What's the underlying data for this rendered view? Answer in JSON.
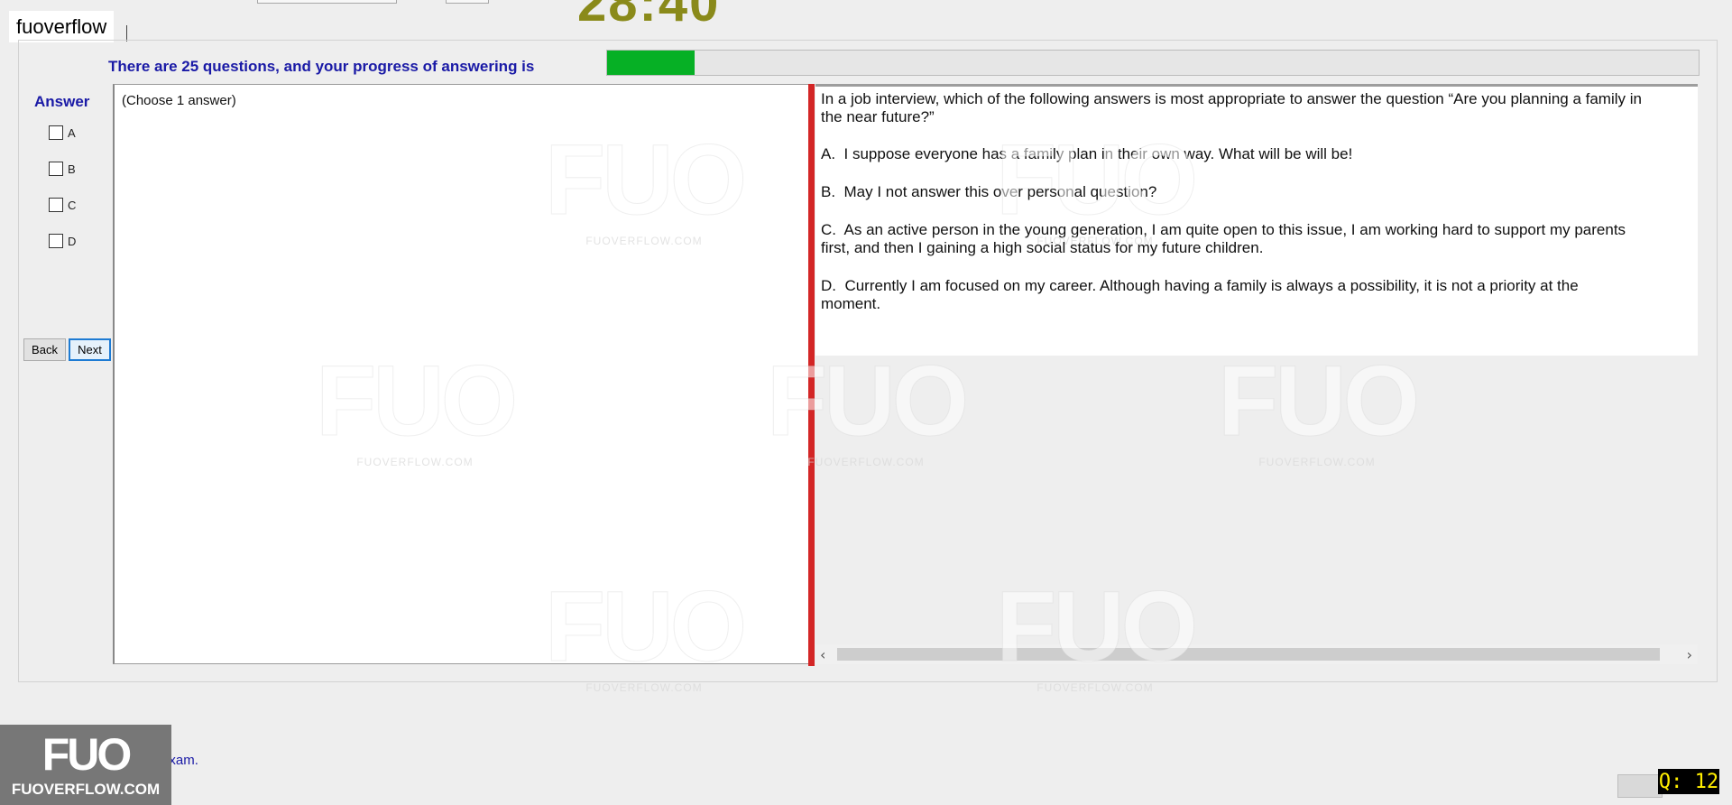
{
  "timer": {
    "display": "28:40"
  },
  "user": {
    "name": "fuoverflow"
  },
  "progress": {
    "label": "There are 25 questions, and your progress of answering is",
    "fraction": 0.08
  },
  "answer": {
    "title": "Answer",
    "options": [
      {
        "label": "A",
        "checked": false
      },
      {
        "label": "B",
        "checked": false
      },
      {
        "label": "C",
        "checked": false
      },
      {
        "label": "D",
        "checked": false
      }
    ],
    "instructions": "(Choose 1 answer)"
  },
  "nav": {
    "back_label": "Back",
    "next_label": "Next"
  },
  "question": {
    "stem": "In a job interview, which of the following answers is most appropriate to answer the question “Are you planning a family in the near future?”",
    "options": [
      {
        "letter": "A.",
        "text": "I suppose everyone has a family plan in their own way. What will be will be!"
      },
      {
        "letter": "B.",
        "text": "May I not answer this over personal question?"
      },
      {
        "letter": "C.",
        "text": "As an active person in the young generation, I am quite open to this issue, I am working hard to support my parents first, and then I gaining a high social status for my future children."
      },
      {
        "letter": "D.",
        "text": "Currently I am focused on my career. Although having a family is always a possibility, it is not a priority at the moment."
      }
    ]
  },
  "scroll": {
    "left_icon": "chevron-left-icon",
    "right_icon": "chevron-right-icon"
  },
  "watermark": {
    "brand_big": "FUO",
    "brand_small": "FUOVERFLOW.COM"
  },
  "logo": {
    "big": "FUO",
    "small": "FUOVERFLOW.COM"
  },
  "finish": {
    "label": "I want to finish the exam.",
    "checked": false
  },
  "question_number": {
    "display": "Q: 12"
  },
  "colors": {
    "accent_text": "#1a1aa6",
    "progress_fill": "#06b025",
    "splitter": "#d32626",
    "timer": "#8a8a1a"
  }
}
